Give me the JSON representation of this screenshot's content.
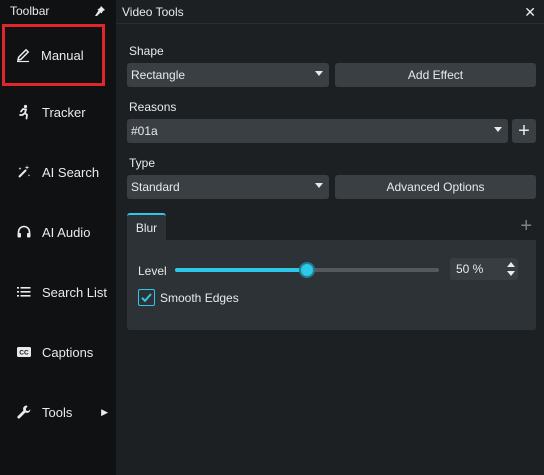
{
  "toolbar": {
    "title": "Toolbar",
    "items": [
      {
        "label": "Manual",
        "icon": "pencil-icon",
        "selected": true
      },
      {
        "label": "Tracker",
        "icon": "running-person-icon"
      },
      {
        "label": "AI Search",
        "icon": "magic-wand-icon"
      },
      {
        "label": "AI Audio",
        "icon": "headset-icon"
      },
      {
        "label": "Search List",
        "icon": "list-search-icon"
      },
      {
        "label": "Captions",
        "icon": "cc-icon"
      },
      {
        "label": "Tools",
        "icon": "wrench-icon",
        "has_submenu": true
      }
    ]
  },
  "panel": {
    "title": "Video Tools",
    "shape": {
      "label": "Shape",
      "value": "Rectangle",
      "button": "Add Effect"
    },
    "reasons": {
      "label": "Reasons",
      "value": "#01a"
    },
    "type": {
      "label": "Type",
      "value": "Standard",
      "button": "Advanced Options"
    },
    "effect_tab": {
      "label": "Blur"
    },
    "level": {
      "label": "Level",
      "value": 50,
      "display": "50 %"
    },
    "smooth_edges": {
      "label": "Smooth Edges",
      "checked": true
    }
  },
  "colors": {
    "accent": "#2ec7e8",
    "selection_outline": "#e0262a",
    "toolbar_bg": "#0f1112",
    "panel_bg": "#1d2023",
    "control_bg": "#3a3f44"
  }
}
